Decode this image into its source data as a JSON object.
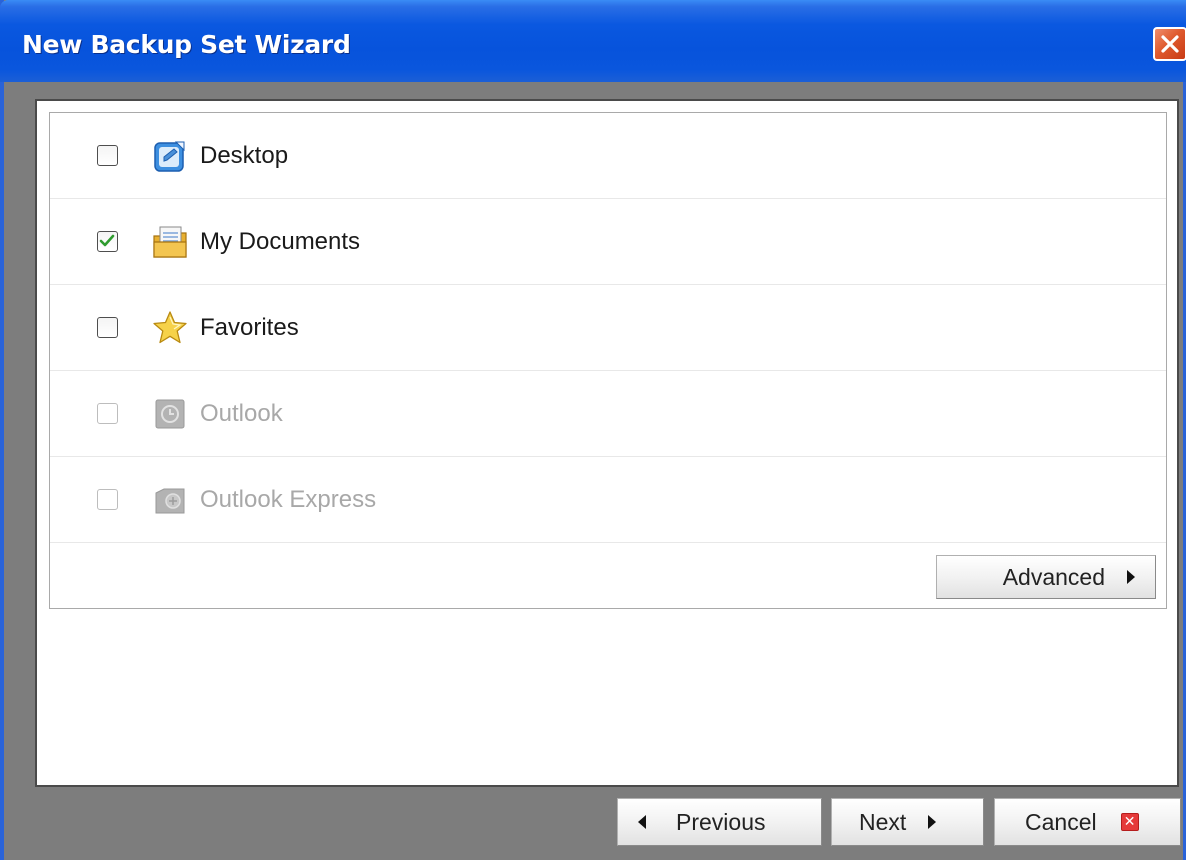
{
  "window": {
    "title": "New Backup Set Wizard"
  },
  "items": [
    {
      "label": "Desktop",
      "checked": false,
      "enabled": true,
      "icon": "desktop-icon"
    },
    {
      "label": "My Documents",
      "checked": true,
      "enabled": true,
      "icon": "my-documents-icon"
    },
    {
      "label": "Favorites",
      "checked": false,
      "enabled": true,
      "icon": "favorites-star-icon"
    },
    {
      "label": "Outlook",
      "checked": false,
      "enabled": false,
      "icon": "outlook-icon"
    },
    {
      "label": "Outlook Express",
      "checked": false,
      "enabled": false,
      "icon": "outlook-express-icon"
    }
  ],
  "buttons": {
    "advanced": "Advanced",
    "previous": "Previous",
    "next": "Next",
    "cancel": "Cancel"
  },
  "colors": {
    "titlebar": "#0753dc",
    "close": "#df5a2e",
    "checkmark": "#2e9b2e",
    "disabled_text": "#a8a8a8"
  }
}
